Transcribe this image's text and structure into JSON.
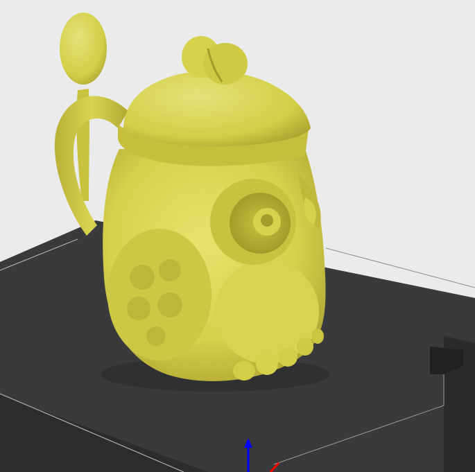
{
  "viewport": {
    "background_color": "#ebebeb",
    "bed_color": "#3a3a3c",
    "bed_edge_color": "#262626",
    "bed_line_color": "#9a9a9a",
    "model_color": "#d6d24c",
    "model_shadow_color": "#a9a130",
    "model_highlight_color": "#e6e27a",
    "axis_z_color": "#0000ff",
    "axis_x_color": "#ff0000"
  },
  "model": {
    "name": "owl-mug-with-lid-and-spoon"
  },
  "icons": {
    "axis_gizmo": "xyz-axis-icon"
  }
}
